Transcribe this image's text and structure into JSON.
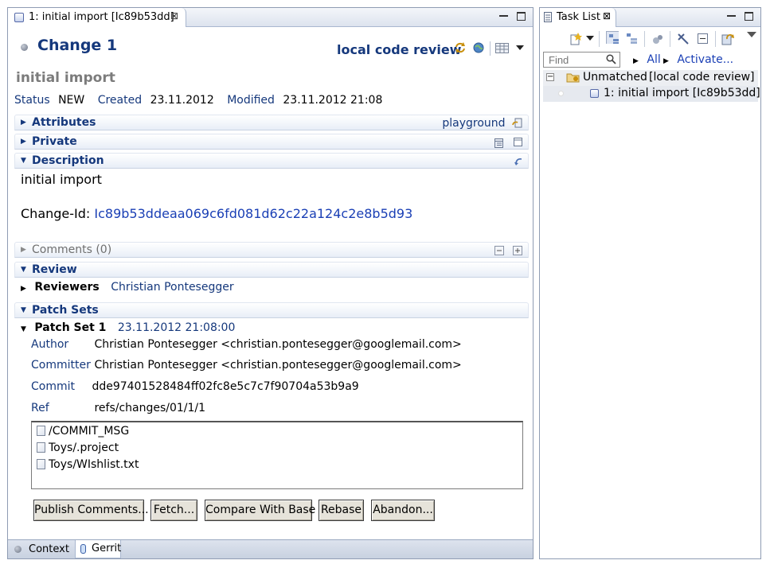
{
  "editor": {
    "tab_label": "1: initial import [Ic89b53dd]",
    "close_glyph": "⊠",
    "title": "Change 1",
    "connector": "local code review",
    "summary": "initial import",
    "status": {
      "status_label": "Status",
      "status_value": "NEW",
      "created_label": "Created",
      "created_value": "23.11.2012",
      "modified_label": "Modified",
      "modified_value": "23.11.2012 21:08"
    },
    "sections": {
      "attributes": {
        "title": "Attributes",
        "right": "playground"
      },
      "private": {
        "title": "Private"
      },
      "description": {
        "title": "Description"
      },
      "comments": {
        "title": "Comments (0)"
      },
      "review": {
        "title": "Review"
      },
      "patch_sets": {
        "title": "Patch Sets"
      }
    },
    "description_text": "initial import",
    "change_id_label": "Change-Id:",
    "change_id_value": "Ic89b53ddeaa069c6fd081d62c22a124c2e8b5d93",
    "reviewers_label": "Reviewers",
    "reviewers_value": "Christian Pontesegger",
    "patch_set": {
      "title": "Patch Set 1",
      "date": "23.11.2012 21:08:00",
      "author_label": "Author",
      "author_value": "Christian Pontesegger <christian.pontesegger@googlemail.com>",
      "committer_label": "Committer",
      "committer_value": "Christian Pontesegger <christian.pontesegger@googlemail.com>",
      "commit_label": "Commit",
      "commit_value": "dde97401528484ff02fc8e5c7c7f90704a53b9a9",
      "ref_label": "Ref",
      "ref_value": "refs/changes/01/1/1",
      "files": [
        "/COMMIT_MSG",
        "Toys/.project",
        "Toys/WIshlist.txt"
      ]
    },
    "buttons": {
      "publish": "Publish Comments...",
      "fetch": "Fetch...",
      "compare": "Compare With Base",
      "rebase": "Rebase",
      "abandon": "Abandon..."
    },
    "bottom_tabs": {
      "context": "Context",
      "gerrit": "Gerrit"
    }
  },
  "task_list": {
    "tab_label": "Task List",
    "find_placeholder": "Find",
    "filter_all": "All",
    "filter_activate": "Activate...",
    "tree": {
      "category": "Unmatched",
      "category_repo": "[local code review]",
      "task": "1: initial import [Ic89b53dd]"
    }
  },
  "colors": {
    "accent": "#15387c",
    "link": "#1a3fb5",
    "summary_grey": "#7c7c7c"
  }
}
